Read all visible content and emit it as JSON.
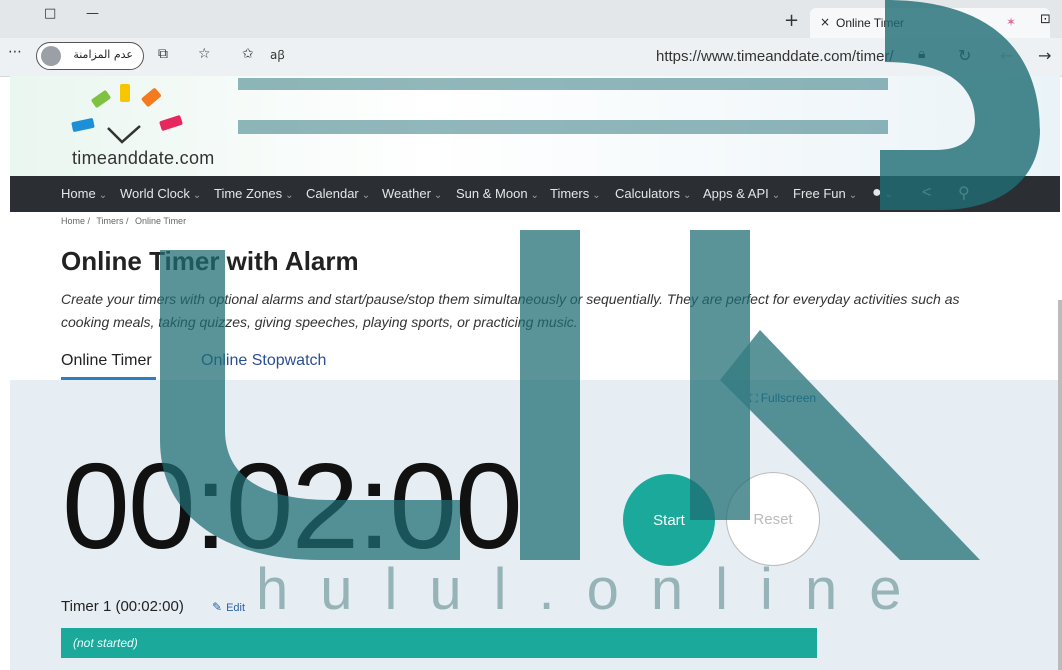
{
  "browser": {
    "window_controls": [
      "□",
      "—"
    ],
    "new_tab_icon": "+",
    "tab_title": "Online Timer",
    "tab_close": "×",
    "tab_menu": "⊡",
    "profile_label": "عدم المزامنة",
    "read_aloud": "aꞵ",
    "url": "https://www.timeanddate.com/timer/"
  },
  "site": {
    "logo_text": "timeanddate.com",
    "logo_colors": [
      "#7fc241",
      "#f7c600",
      "#f47a1f",
      "#1d8fd6",
      "#e6285e"
    ],
    "nav": [
      {
        "label": "Home",
        "caret": "⌄"
      },
      {
        "label": "World Clock",
        "caret": "⌄"
      },
      {
        "label": "Time Zones",
        "caret": "⌄"
      },
      {
        "label": "Calendar",
        "caret": "⌄"
      },
      {
        "label": "Weather",
        "caret": "⌄"
      },
      {
        "label": "Sun & Moon",
        "caret": "⌄"
      },
      {
        "label": "Timers",
        "caret": "⌄"
      },
      {
        "label": "Calculators",
        "caret": "⌄"
      },
      {
        "label": "Apps & API",
        "caret": "⌄"
      },
      {
        "label": "Free Fun",
        "caret": "⌄"
      }
    ],
    "breadcrumb": [
      "Home /",
      "Timers /",
      "Online Timer"
    ]
  },
  "page": {
    "title": "Online Timer with Alarm",
    "intro": "Create your timers with optional alarms and start/pause/stop them simultaneously or sequentially. They are perfect for everyday activities such as cooking meals, taking quizzes, giving speeches, playing sports, or practicing music.",
    "tabs": [
      "Online Timer",
      "Online Stopwatch"
    ],
    "fullscreen": "Fullscreen"
  },
  "timer": {
    "display": "00:02:00",
    "start_label": "Start",
    "reset_label": "Reset",
    "name": "Timer 1 (00:02:00)",
    "edit_label": "Edit",
    "status": "(not started)",
    "accent": "#1aa99a"
  },
  "watermark": {
    "text": "hulul.online",
    "arabic": "الحلول الجاهزة",
    "color": "#1f6e74"
  }
}
